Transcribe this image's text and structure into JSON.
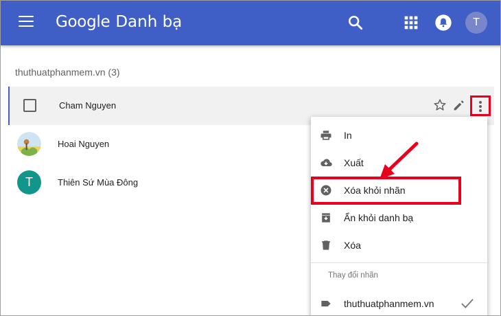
{
  "header": {
    "brand_google": "Google",
    "brand_product": "Danh bạ",
    "avatar_initial": "T",
    "color": "#3f5fc6"
  },
  "group": {
    "title": "thuthuatphanmem.vn (3)"
  },
  "contacts": [
    {
      "name": "Cham Nguyen",
      "avatar": "checkbox",
      "selected": true
    },
    {
      "name": "Hoai Nguyen",
      "avatar": "photo"
    },
    {
      "name": "Thiên Sứ Mùa Đông",
      "avatar": "T",
      "avatar_color": "#12968b"
    }
  ],
  "menu": {
    "items": [
      {
        "label": "In",
        "icon": "print-icon"
      },
      {
        "label": "Xuất",
        "icon": "cloud-download-icon"
      },
      {
        "label": "Xóa khỏi nhãn",
        "icon": "remove-circle-icon"
      },
      {
        "label": "Ẩn khỏi danh bạ",
        "icon": "archive-icon"
      },
      {
        "label": "Xóa",
        "icon": "trash-icon"
      }
    ],
    "section_label": "Thay đổi nhãn",
    "labels": [
      {
        "label": "thuthuatphanmem.vn",
        "icon": "label-icon",
        "checked": true
      }
    ]
  },
  "annotation_color": "#e8001c"
}
